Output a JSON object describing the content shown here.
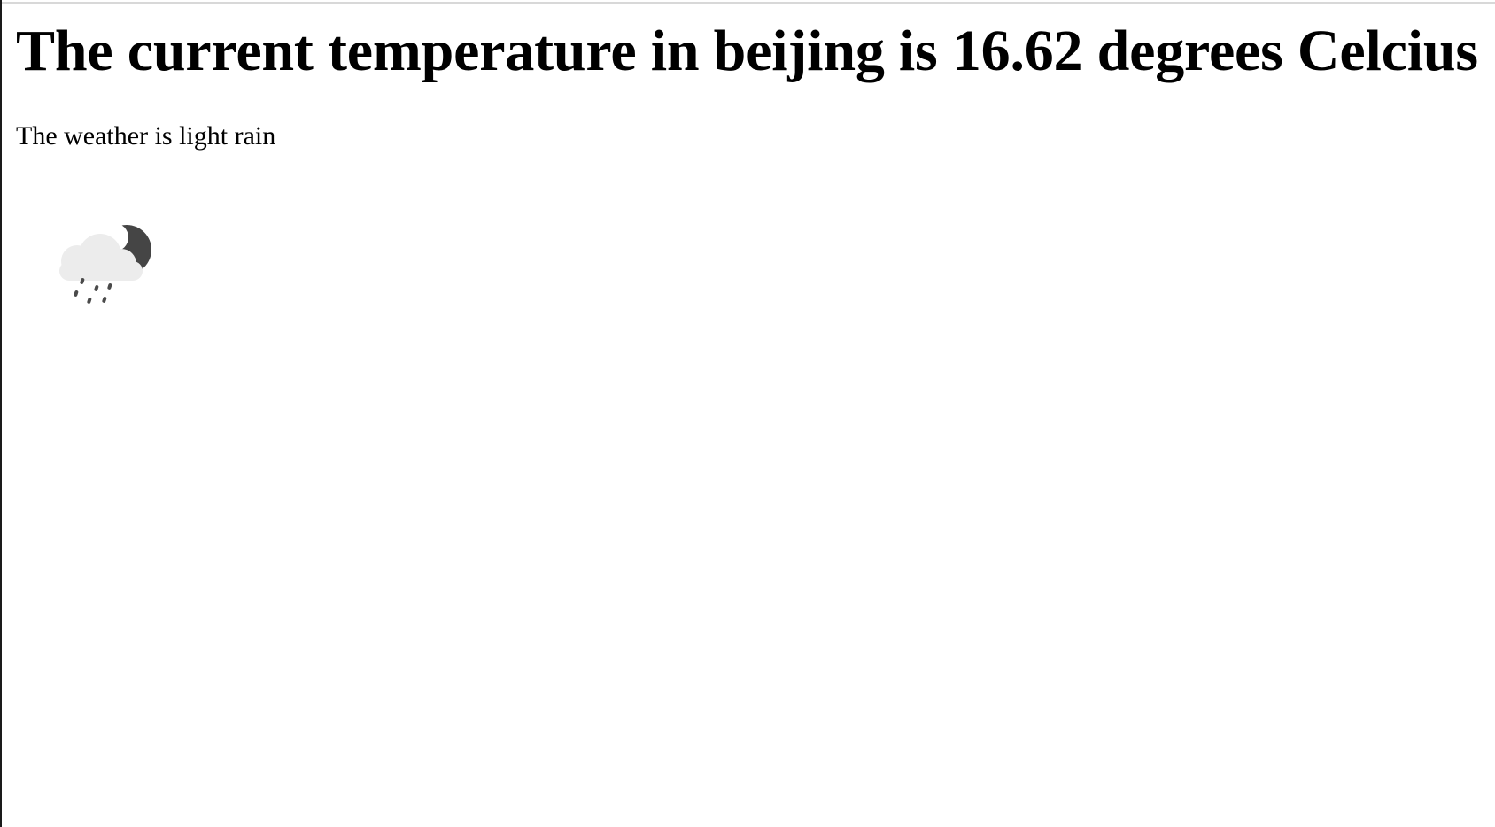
{
  "weather": {
    "heading": "The current temperature in beijing is 16.62 degrees Celcius",
    "description": "The weather is light rain",
    "icon": "moon-cloud-rain-icon"
  },
  "colors": {
    "moon": "#454545",
    "cloud": "#ececec",
    "rain": "#4a4a4a"
  }
}
